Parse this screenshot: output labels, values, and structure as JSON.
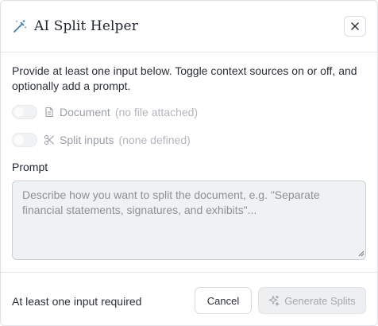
{
  "dialog": {
    "title": "AI Split Helper",
    "title_icon": "magic-wand-icon",
    "close_icon": "close-icon"
  },
  "description": "Provide at least one input below. Toggle context sources on or off, and optionally add a prompt.",
  "sources": [
    {
      "label": "Document",
      "sub": "(no file attached)",
      "icon": "document-icon",
      "enabled": false
    },
    {
      "label": "Split inputs",
      "sub": "(none defined)",
      "icon": "scissors-icon",
      "enabled": false
    }
  ],
  "prompt": {
    "label": "Prompt",
    "placeholder": "Describe how you want to split the document, e.g. \"Separate financial statements, signatures, and exhibits\"...",
    "value": ""
  },
  "footer": {
    "note": "At least one input required",
    "cancel_label": "Cancel",
    "generate_label": "Generate Splits",
    "generate_icon": "sparkles-icon"
  },
  "colors": {
    "accent": "#2f7ab5",
    "prompt_bg": "#eff2f3",
    "disabled_text": "#a5a8af"
  }
}
